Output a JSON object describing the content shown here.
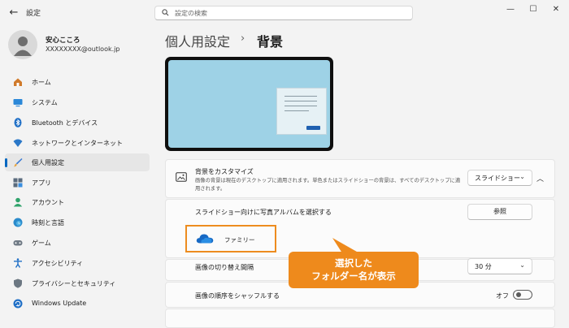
{
  "window": {
    "app_title": "設定",
    "controls": {
      "minimize": "—",
      "maximize": "☐",
      "close": "✕"
    }
  },
  "search": {
    "placeholder": "設定の検索"
  },
  "profile": {
    "name": "安心こころ",
    "email": "XXXXXXXX@outlook.jp"
  },
  "sidebar": {
    "items": [
      {
        "label": "ホーム",
        "icon": "home-icon"
      },
      {
        "label": "システム",
        "icon": "system-icon"
      },
      {
        "label": "Bluetooth とデバイス",
        "icon": "bluetooth-icon"
      },
      {
        "label": "ネットワークとインターネット",
        "icon": "network-icon"
      },
      {
        "label": "個人用設定",
        "icon": "personalization-icon",
        "selected": true
      },
      {
        "label": "アプリ",
        "icon": "apps-icon"
      },
      {
        "label": "アカウント",
        "icon": "accounts-icon"
      },
      {
        "label": "時刻と言語",
        "icon": "time-language-icon"
      },
      {
        "label": "ゲーム",
        "icon": "gaming-icon"
      },
      {
        "label": "アクセシビリティ",
        "icon": "accessibility-icon"
      },
      {
        "label": "プライバシーとセキュリティ",
        "icon": "privacy-icon"
      },
      {
        "label": "Windows Update",
        "icon": "windows-update-icon"
      }
    ]
  },
  "breadcrumb": {
    "parent": "個人用設定",
    "separator": "›",
    "current": "背景"
  },
  "background": {
    "title": "背景をカスタマイズ",
    "description": "画像の背景は現在のデスクトップに適用されます。単色またはスライドショーの背景は、すべてのデスクトップに適用されます。",
    "type_value": "スライドショー"
  },
  "slideshow": {
    "album_label": "スライドショー向けに写真アルバムを選択する",
    "browse_label": "参照",
    "folder_name": "ファミリー"
  },
  "interval": {
    "label": "画像の切り替え間隔",
    "value": "30 分"
  },
  "shuffle": {
    "label": "画像の順序をシャッフルする",
    "state_label": "オフ",
    "on": false
  },
  "callout": {
    "line1": "選択した",
    "line2": "フォルダー名が表示"
  },
  "colors": {
    "accent": "#0067c0",
    "callout": "#ee8a1c",
    "folder_highlight": "#ed8c1f"
  }
}
